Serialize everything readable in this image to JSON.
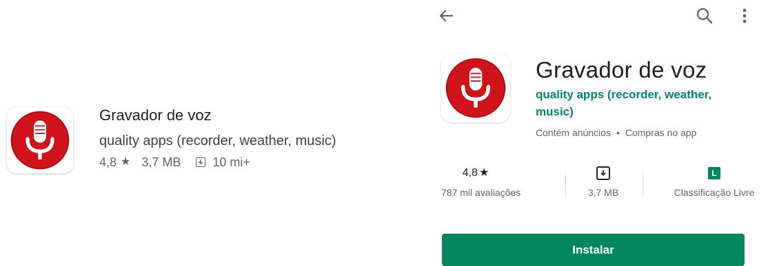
{
  "colors": {
    "accent_green": "#01875f",
    "icon_red": "#d0121a",
    "text_primary": "#202124",
    "text_secondary": "#5f6368"
  },
  "search_result": {
    "title": "Gravador de voz",
    "developer": "quality apps (recorder, weather, music)",
    "rating": "4,8",
    "rating_icon": "star-icon",
    "size": "3,7 MB",
    "installs_icon": "download-icon",
    "installs": "10 mi+"
  },
  "details": {
    "top_bar": {
      "back_icon": "arrow-back-icon",
      "search_icon": "search-icon",
      "more_icon": "more-vertical-icon"
    },
    "title": "Gravador de voz",
    "developer": "quality apps (recorder, weather, music)",
    "contains_ads": "Contém anúncios",
    "separator": "•",
    "in_app_purchases": "Compras no app",
    "stats": {
      "rating_value": "4,8",
      "rating_label": "787 mil avaliações",
      "size_label": "3,7 MB",
      "content_rating_badge": "L",
      "content_rating_label": "Classificação Livre"
    },
    "install_label": "Instalar"
  }
}
